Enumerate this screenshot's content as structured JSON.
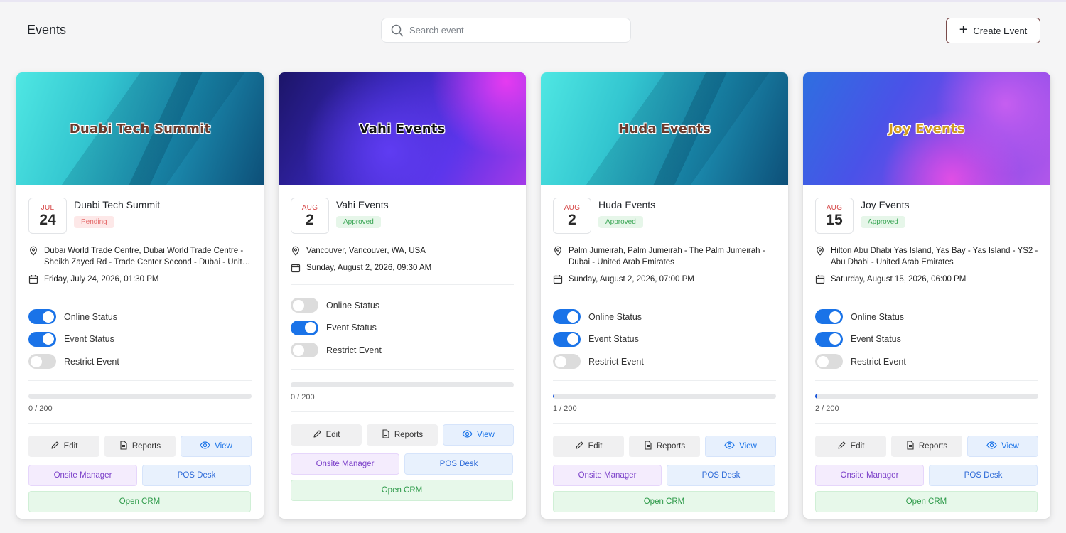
{
  "header": {
    "title": "Events",
    "search_placeholder": "Search event",
    "create_label": "Create Event"
  },
  "labels": {
    "online_status": "Online Status",
    "event_status": "Event Status",
    "restrict_event": "Restrict Event",
    "edit": "Edit",
    "reports": "Reports",
    "view": "View",
    "onsite_manager": "Onsite Manager",
    "pos_desk": "POS Desk",
    "open_crm": "Open CRM"
  },
  "colors": {
    "accent": "#1a73e8",
    "pending": "#e56b6b",
    "approved": "#3aa655"
  },
  "events": [
    {
      "banner_title": "Duabi Tech Summit",
      "month": "JUL",
      "day": "24",
      "name": "Duabi Tech Summit",
      "status": "Pending",
      "location": "Dubai World Trade Centre, Dubai World Trade Centre - Sheikh Zayed Rd - Trade Center Second - Dubai - United Arab Emirates",
      "datetime": "Friday, July 24, 2026, 01:30 PM",
      "online_status": true,
      "event_status": true,
      "restrict_event": false,
      "sold": 0,
      "capacity": 200,
      "count_text": "0 / 200"
    },
    {
      "banner_title": "Vahi Events",
      "month": "AUG",
      "day": "2",
      "name": "Vahi Events",
      "status": "Approved",
      "location": "Vancouver, Vancouver, WA, USA",
      "datetime": "Sunday, August 2, 2026, 09:30 AM",
      "online_status": false,
      "event_status": true,
      "restrict_event": false,
      "sold": 0,
      "capacity": 200,
      "count_text": "0 / 200"
    },
    {
      "banner_title": "Huda Events",
      "month": "AUG",
      "day": "2",
      "name": "Huda Events",
      "status": "Approved",
      "location": "Palm Jumeirah, Palm Jumeirah - The Palm Jumeirah - Dubai - United Arab Emirates",
      "datetime": "Sunday, August 2, 2026, 07:00 PM",
      "online_status": true,
      "event_status": true,
      "restrict_event": false,
      "sold": 1,
      "capacity": 200,
      "count_text": "1 / 200"
    },
    {
      "banner_title": "Joy Events",
      "month": "AUG",
      "day": "15",
      "name": "Joy Events",
      "status": "Approved",
      "location": "Hilton Abu Dhabi Yas Island, Yas Bay - Yas Island - YS2 - Abu Dhabi - United Arab Emirates",
      "datetime": "Saturday, August 15, 2026, 06:00 PM",
      "online_status": true,
      "event_status": true,
      "restrict_event": false,
      "sold": 2,
      "capacity": 200,
      "count_text": "2 / 200"
    }
  ]
}
